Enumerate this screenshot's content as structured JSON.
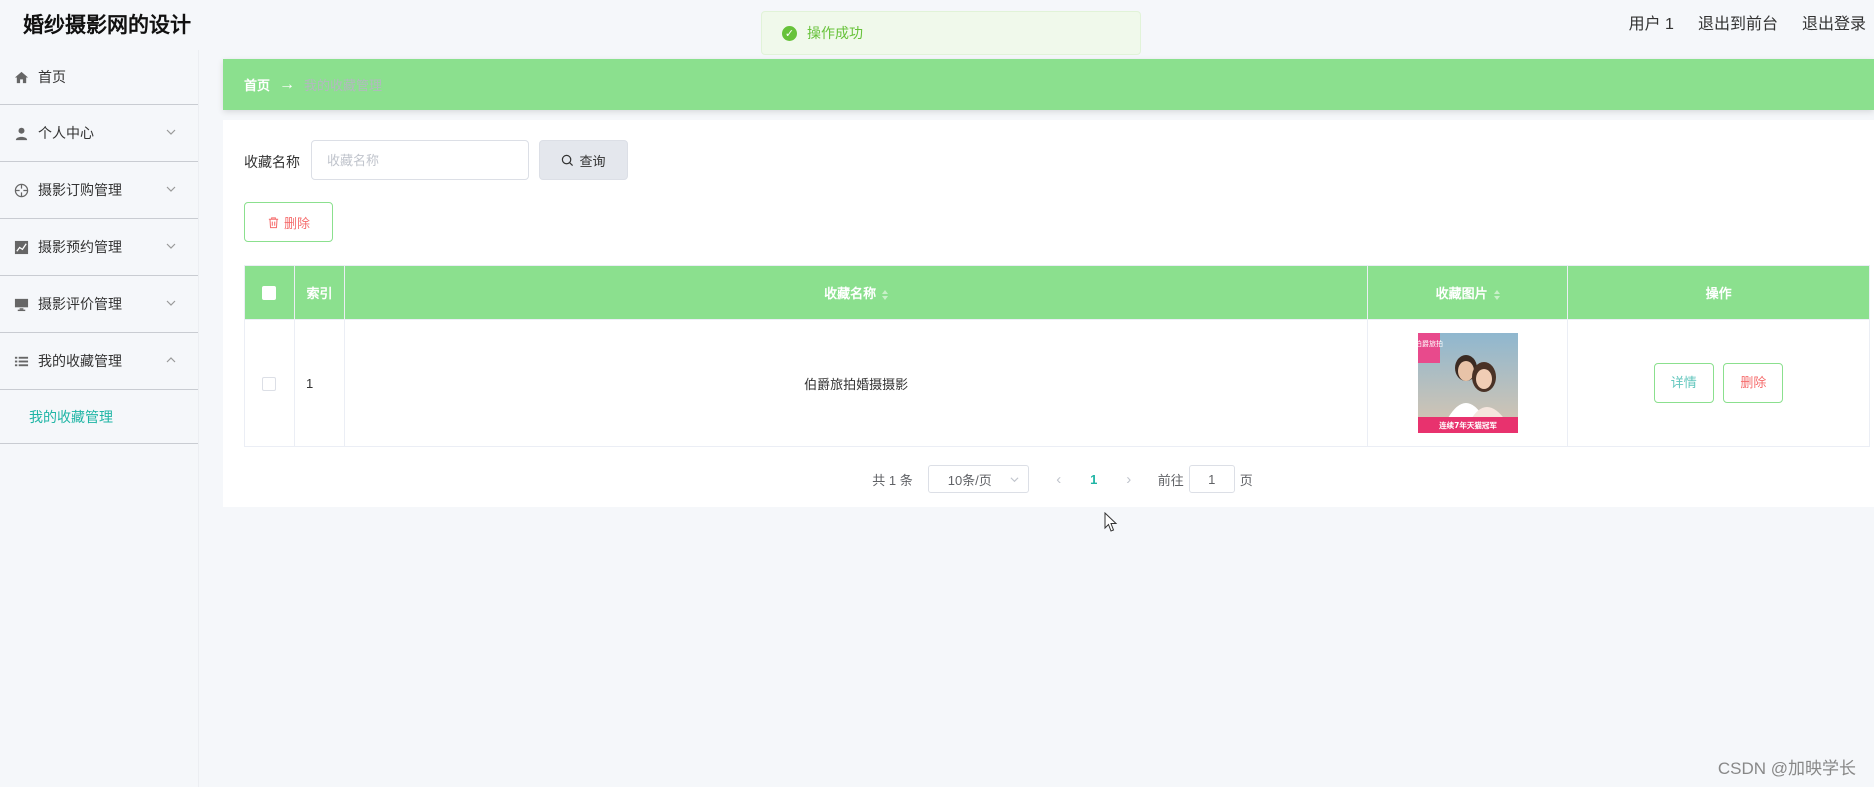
{
  "header": {
    "title": "婚纱摄影网的设计",
    "user": "用户 1",
    "back_to_front": "退出到前台",
    "logout": "退出登录"
  },
  "toast": {
    "message": "操作成功"
  },
  "sidebar": {
    "items": [
      {
        "label": "首页",
        "icon": "home-icon"
      },
      {
        "label": "个人中心",
        "icon": "user-icon"
      },
      {
        "label": "摄影订购管理",
        "icon": "aperture-icon"
      },
      {
        "label": "摄影预约管理",
        "icon": "chart-icon"
      },
      {
        "label": "摄影评价管理",
        "icon": "monitor-icon"
      },
      {
        "label": "我的收藏管理",
        "icon": "list-icon"
      }
    ],
    "sub_item": "我的收藏管理"
  },
  "breadcrumb": {
    "home": "首页",
    "arrow": "→",
    "current": "我的收藏管理"
  },
  "search": {
    "label": "收藏名称",
    "placeholder": "收藏名称",
    "button": "查询"
  },
  "actions": {
    "delete": "删除"
  },
  "table": {
    "columns": [
      "索引",
      "收藏名称",
      "收藏图片",
      "操作"
    ],
    "rows": [
      {
        "index": "1",
        "name": "伯爵旅拍婚摄摄影",
        "detail": "详情",
        "delete": "删除"
      }
    ]
  },
  "image_text": {
    "brand": "伯爵旅拍",
    "banner": "连续7年天猫冠军"
  },
  "pagination": {
    "total": "共 1 条",
    "page_size": "10条/页",
    "current": "1",
    "goto_label": "前往",
    "goto_value": "1",
    "page_unit": "页"
  },
  "watermark": "CSDN @加映学长",
  "colors": {
    "accent": "#8be08e",
    "teal": "#1fb5a5",
    "danger": "#f56c6c",
    "success": "#67c23a"
  }
}
